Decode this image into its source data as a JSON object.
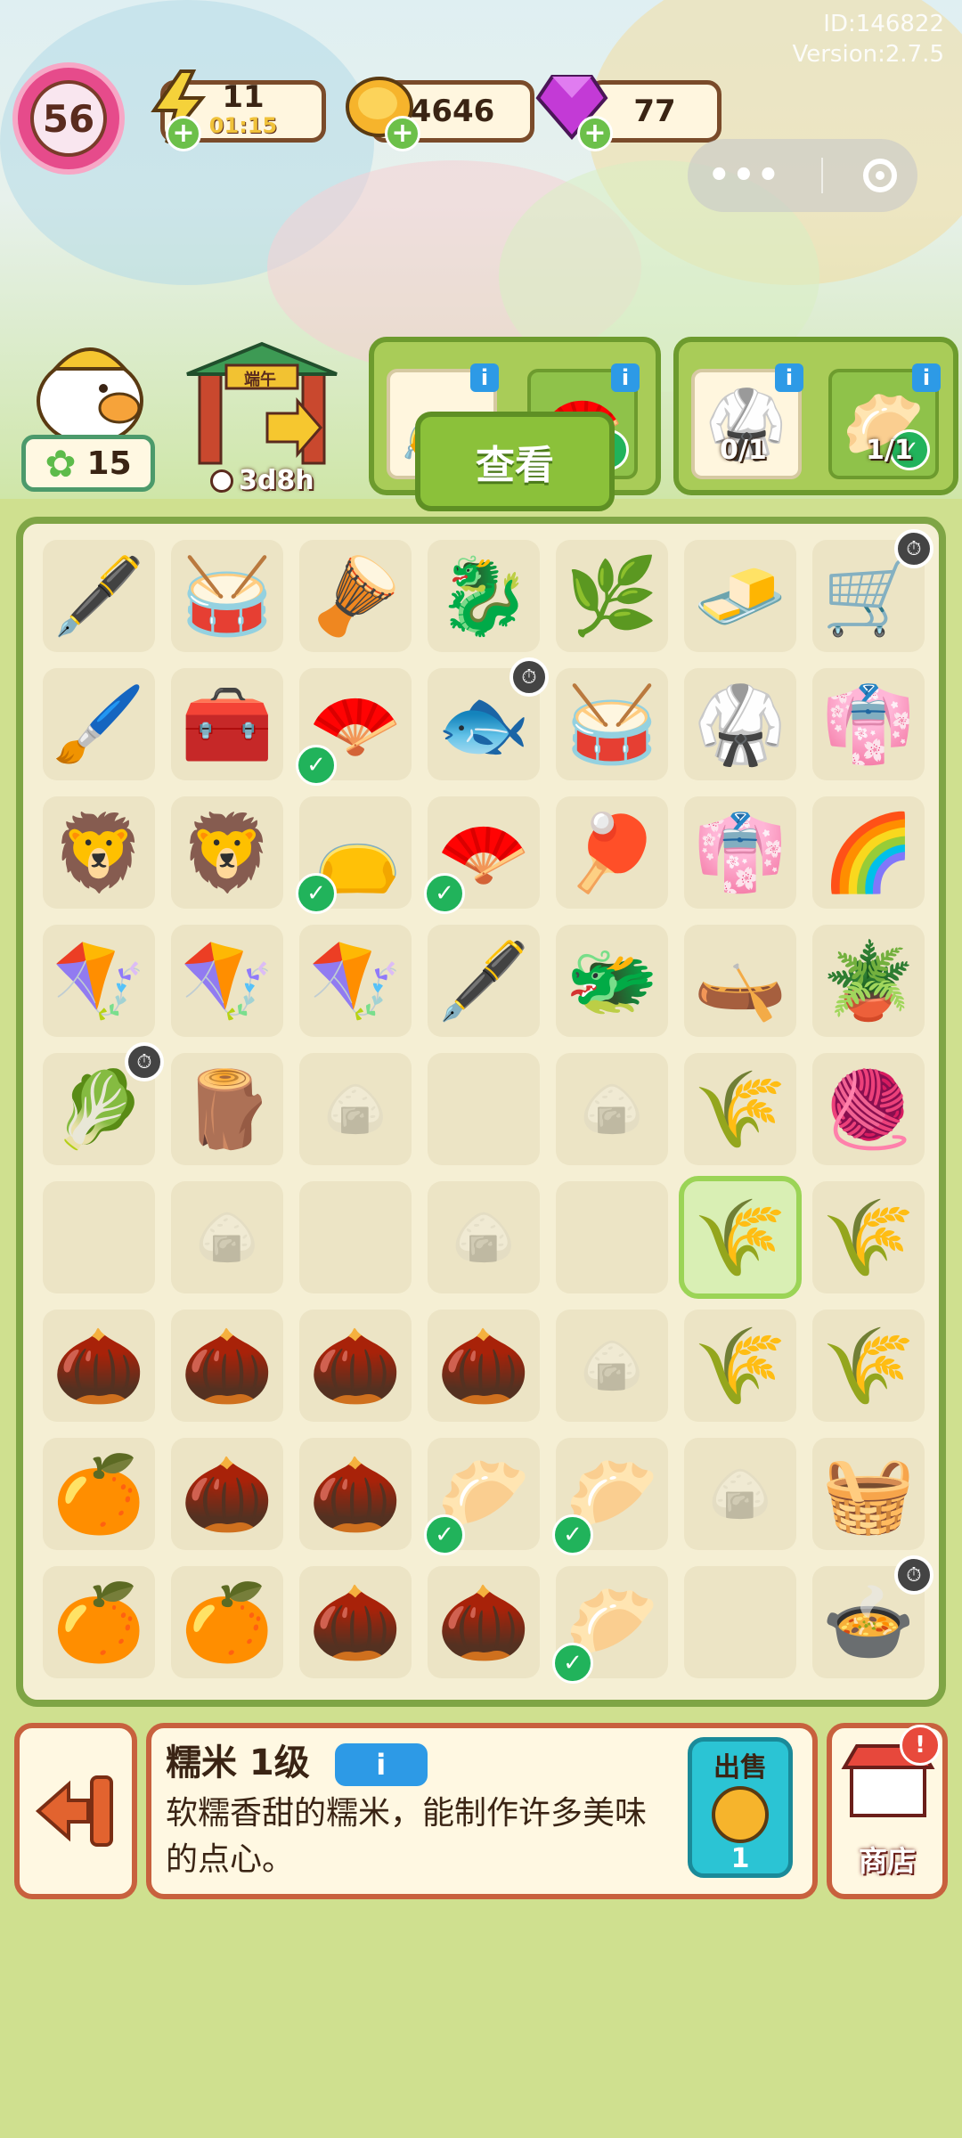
{
  "meta": {
    "id_line": "ID:146822",
    "version_line": "Version:2.7.5"
  },
  "player": {
    "level": "56"
  },
  "resources": {
    "energy": {
      "value": "11",
      "timer": "01:15",
      "icon": "lightning-icon"
    },
    "coins": {
      "value": "4646",
      "icon": "coin-icon"
    },
    "gems": {
      "value": "77",
      "icon": "gem-icon"
    }
  },
  "capsule": {
    "more_icon": "more-dots-icon",
    "close_icon": "target-circle-icon"
  },
  "mascot": {
    "count": "15"
  },
  "event": {
    "timer": "3d8h",
    "gate_text": "端午"
  },
  "orders": [
    {
      "items": [
        "coin-pouch",
        "scroll-fan"
      ],
      "done": [
        false,
        true
      ]
    },
    {
      "items": [
        "kimono",
        "steamed-buns"
      ],
      "done": [
        false,
        true
      ],
      "progress": [
        "0/1",
        "1/1"
      ]
    }
  ],
  "view_button": "查看",
  "board": {
    "rows": [
      [
        {
          "e": "🖋️"
        },
        {
          "e": "🥁"
        },
        {
          "e": "🪘"
        },
        {
          "e": "🐉"
        },
        {
          "e": "🌿"
        },
        {
          "e": "🧈"
        },
        {
          "e": "🛒",
          "c": 1
        }
      ],
      [
        {
          "e": "🖌️"
        },
        {
          "e": "🧰"
        },
        {
          "e": "🪭",
          "k": 1
        },
        {
          "e": "🐟",
          "c": 1
        },
        {
          "e": "🥁"
        },
        {
          "e": "🥋"
        },
        {
          "e": "👘"
        }
      ],
      [
        {
          "e": "🦁"
        },
        {
          "e": "🦁"
        },
        {
          "e": "👝",
          "k": 1
        },
        {
          "e": "🪭",
          "k": 1
        },
        {
          "e": "🏓"
        },
        {
          "e": "👘"
        },
        {
          "e": "🌈"
        }
      ],
      [
        {
          "e": "🪁"
        },
        {
          "e": "🪁"
        },
        {
          "e": "🪁"
        },
        {
          "e": "🖋️"
        },
        {
          "e": "🐲"
        },
        {
          "e": "🛶"
        },
        {
          "e": "🪴"
        }
      ],
      [
        {
          "e": "🥬",
          "c": 1
        },
        {
          "e": "🪵"
        },
        {
          "e": "🍙"
        },
        {
          "e": ""
        },
        {
          "e": "🍙"
        },
        {
          "e": "🌾"
        },
        {
          "e": "🧶"
        }
      ],
      [
        {
          "e": ""
        },
        {
          "e": "🍙"
        },
        {
          "e": ""
        },
        {
          "e": "🍙"
        },
        {
          "e": ""
        },
        {
          "e": "🌾",
          "h": 1
        },
        {
          "e": "🌾"
        }
      ],
      [
        {
          "e": "🌰"
        },
        {
          "e": "🌰"
        },
        {
          "e": "🌰"
        },
        {
          "e": "🌰"
        },
        {
          "e": "🍙"
        },
        {
          "e": "🌾"
        },
        {
          "e": "🌾"
        }
      ],
      [
        {
          "e": "🍊"
        },
        {
          "e": "🌰"
        },
        {
          "e": "🌰"
        },
        {
          "e": "🥟",
          "k": 1
        },
        {
          "e": "🥟",
          "k": 1
        },
        {
          "e": "🍙"
        },
        {
          "e": "🧺"
        }
      ],
      [
        {
          "e": "🍊"
        },
        {
          "e": "🍊"
        },
        {
          "e": "🌰"
        },
        {
          "e": "🌰"
        },
        {
          "e": "🥟",
          "k": 1
        },
        {
          "e": ""
        },
        {
          "e": "🍲",
          "c": 1
        }
      ]
    ]
  },
  "selected": {
    "name": "糯米 1级",
    "description": "软糯香甜的糯米，能制作许多美味的点心。",
    "sell_label": "出售",
    "sell_value": "1"
  },
  "shop": {
    "label": "商店"
  },
  "colors": {
    "board_border": "#7fa545",
    "accent_green": "#8bc13a",
    "sell_teal": "#2bc4d4",
    "frame_orange": "#c8613e"
  }
}
